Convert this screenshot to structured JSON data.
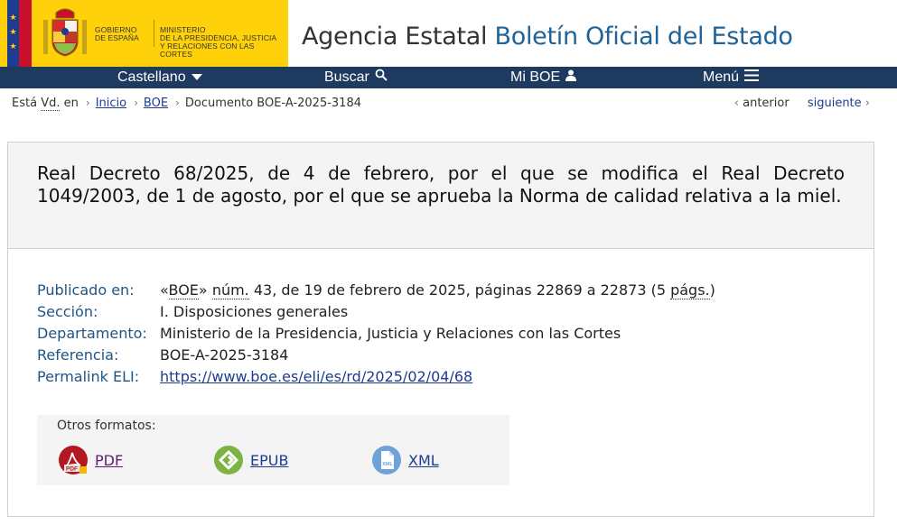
{
  "header": {
    "gov_line1": "Gobierno",
    "gov_line2": "de España",
    "ministry_line1": "Ministerio",
    "ministry_line2": "de la Presidencia, Justicia",
    "ministry_line3": "y Relaciones con las Cortes",
    "agency_prefix": "Agencia Estatal",
    "agency_name": "Boletín Oficial del Estado"
  },
  "nav": {
    "language": "Castellano",
    "search": "Buscar",
    "my_boe": "Mi BOE",
    "menu": "Menú"
  },
  "breadcrumb": {
    "prefix1": "Está",
    "prefix_abbr": "Vd.",
    "prefix2": "en",
    "items": [
      "Inicio",
      "BOE"
    ],
    "current": "Documento BOE-A-2025-3184"
  },
  "pager": {
    "previous": "anterior",
    "next": "siguiente"
  },
  "document": {
    "title": "Real Decreto 68/2025, de 4 de febrero, por el que se modifica el Real Decreto 1049/2003, de 1 de agosto, por el que se aprueba la Norma de calidad relativa a la miel.",
    "published_label": "Publicado en:",
    "published": {
      "open_quote": "«",
      "boe": "BOE",
      "close_quote": "»",
      "num_abbr": "núm.",
      "rest": "43, de 19 de febrero de 2025, páginas 22869 a 22873 (5",
      "pages_abbr": "págs.",
      "end": ")"
    },
    "section_label": "Sección:",
    "section": "I. Disposiciones generales",
    "department_label": "Departamento:",
    "department": "Ministerio de la Presidencia, Justicia y Relaciones con las Cortes",
    "reference_label": "Referencia:",
    "reference": "BOE-A-2025-3184",
    "eli_label": "Permalink ELI:",
    "eli": "https://www.boe.es/eli/es/rd/2025/02/04/68"
  },
  "formats": {
    "label": "Otros formatos:",
    "pdf": "PDF",
    "epub": "EPUB",
    "xml": "XML"
  },
  "colors": {
    "navbar": "#1e3a5f",
    "gov_yellow": "#ffd10a",
    "link": "#1c3d8f",
    "label_blue": "#1f5585"
  }
}
